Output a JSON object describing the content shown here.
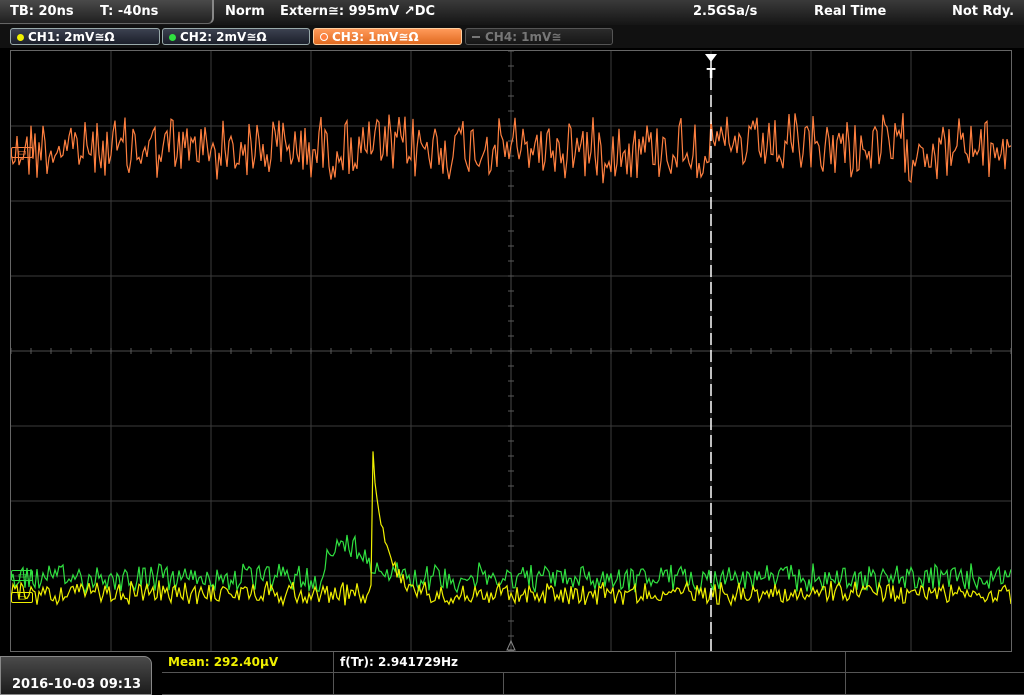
{
  "topbar": {
    "timebase": "TB: 20ns",
    "trigger_time": "T: -40ns",
    "trigger_mode": "Norm",
    "trigger_source": "Extern≅: 995mV ↗DC",
    "sample_rate": "2.5GSa/s",
    "acq_mode": "Real Time",
    "status": "Not Rdy."
  },
  "channels": [
    {
      "label": "CH1: 2mV≅Ω",
      "color": "#f0f000",
      "active": true
    },
    {
      "label": "CH2: 2mV≅Ω",
      "color": "#30e040",
      "active": true
    },
    {
      "label": "CH3: 1mV≅Ω",
      "color": "#ff8040",
      "active": true
    },
    {
      "label": "CH4: 1mV≅",
      "color": "#777777",
      "active": false
    }
  ],
  "trigger_marker": "T",
  "measurements": {
    "mean": "Mean: 292.40µV",
    "freq": "f(Tr): 2.941729Hz"
  },
  "datetime": "2016-10-03 09:13",
  "colors": {
    "ch1": "#f0f000",
    "ch2": "#30e040",
    "ch3": "#ff8040",
    "grid": "#4a4a4a"
  }
}
